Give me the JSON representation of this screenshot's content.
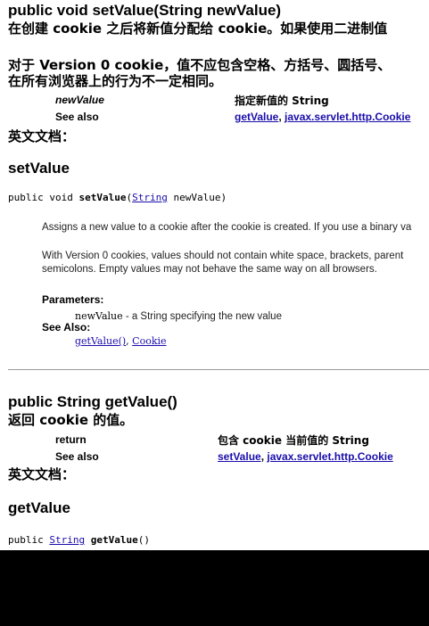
{
  "doc1": {
    "title": "public void setValue(String newValue)",
    "desc_line1": "在创建  cookie 之后将新值分配给  cookie。如果使用二进制值",
    "desc_line2": "对于  Version 0 cookie，值不应包含空格、方括号、圆括号、",
    "desc_line3": "在所有浏览器上的行为不一定相同。",
    "param_name": "newValue",
    "param_desc": "指定新值的 String",
    "see_also_label": "See also",
    "see_link1": "getValue",
    "sep": ", ",
    "see_link2": "javax.servlet.http.Cookie",
    "english_doc": "英文文档："
  },
  "api1": {
    "heading": "setValue",
    "sig_prefix": "public void ",
    "sig_name": "setValue",
    "sig_paren_open": "(",
    "sig_type": "String",
    "sig_rest": " newValue)",
    "para1": "Assigns a new value to a cookie after the cookie is created. If you use a binary va",
    "para2_line1": "With Version 0 cookies, values should not contain white space, brackets, parent",
    "para2_line2": "semicolons. Empty values may not behave the same way on all browsers.",
    "parameters_label": "Parameters:",
    "param_code": "newValue",
    "param_text": " - a String specifying the new value",
    "see_also_label": "See Also:",
    "see_link1": "getValue()",
    "sep": ", ",
    "see_link2": "Cookie"
  },
  "doc2": {
    "title": "public String getValue()",
    "desc": "返回  cookie 的值。",
    "return_label": "return",
    "return_desc": "包含  cookie 当前值的  String",
    "see_also_label": "See also",
    "see_link1": "setValue",
    "sep": ", ",
    "see_link2": "javax.servlet.http.Cookie",
    "english_doc": "英文文档："
  },
  "api2": {
    "heading": "getValue",
    "sig_prefix": "public ",
    "sig_type": "String",
    "sig_space": " ",
    "sig_name": "getValue",
    "sig_rest": "()"
  }
}
